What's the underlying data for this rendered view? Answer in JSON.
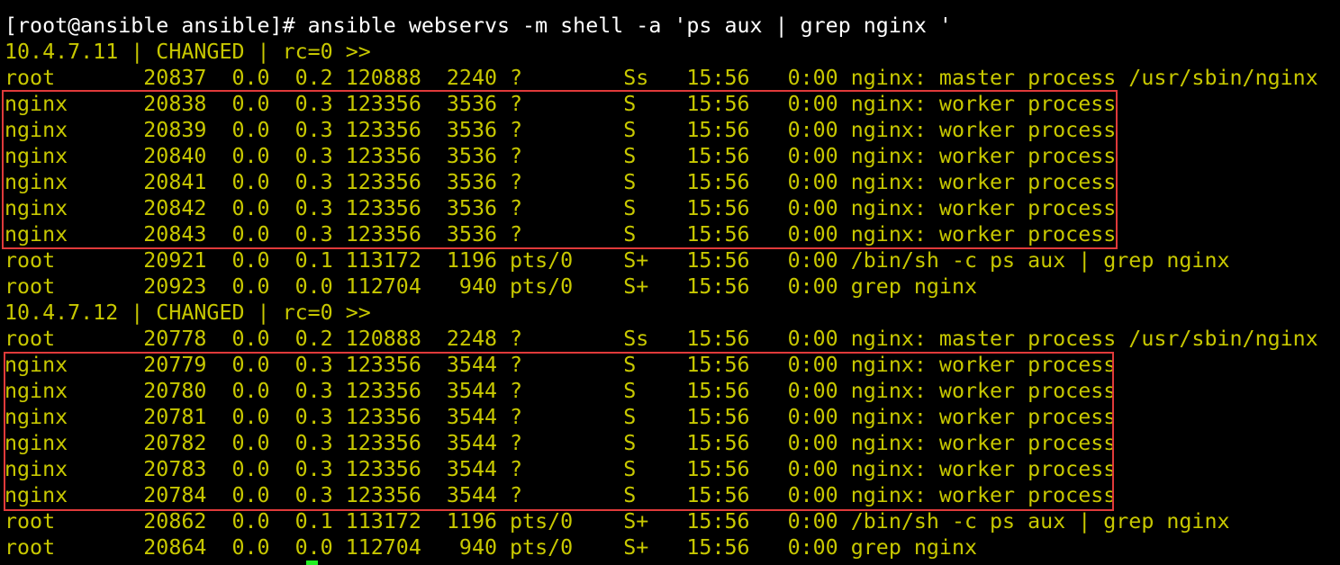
{
  "terminal": {
    "command": "[root@ansible ansible]# ansible webservs -m shell -a 'ps aux | grep nginx '",
    "hosts": [
      {
        "header": "10.4.7.11 | CHANGED | rc=0 >>",
        "master": "root       20837  0.0  0.2 120888  2240 ?        Ss   15:56   0:00 nginx: master process /usr/sbin/nginx",
        "workers": [
          "nginx      20838  0.0  0.3 123356  3536 ?        S    15:56   0:00 nginx: worker process",
          "nginx      20839  0.0  0.3 123356  3536 ?        S    15:56   0:00 nginx: worker process",
          "nginx      20840  0.0  0.3 123356  3536 ?        S    15:56   0:00 nginx: worker process",
          "nginx      20841  0.0  0.3 123356  3536 ?        S    15:56   0:00 nginx: worker process",
          "nginx      20842  0.0  0.3 123356  3536 ?        S    15:56   0:00 nginx: worker process",
          "nginx      20843  0.0  0.3 123356  3536 ?        S    15:56   0:00 nginx: worker process"
        ],
        "tail": [
          "root       20921  0.0  0.1 113172  1196 pts/0    S+   15:56   0:00 /bin/sh -c ps aux | grep nginx",
          "root       20923  0.0  0.0 112704   940 pts/0    S+   15:56   0:00 grep nginx"
        ]
      },
      {
        "header": "10.4.7.12 | CHANGED | rc=0 >>",
        "master": "root       20778  0.0  0.2 120888  2248 ?        Ss   15:56   0:00 nginx: master process /usr/sbin/nginx",
        "workers": [
          "nginx      20779  0.0  0.3 123356  3544 ?        S    15:56   0:00 nginx: worker process",
          "nginx      20780  0.0  0.3 123356  3544 ?        S    15:56   0:00 nginx: worker process",
          "nginx      20781  0.0  0.3 123356  3544 ?        S    15:56   0:00 nginx: worker process",
          "nginx      20782  0.0  0.3 123356  3544 ?        S    15:56   0:00 nginx: worker process",
          "nginx      20783  0.0  0.3 123356  3544 ?        S    15:56   0:00 nginx: worker process",
          "nginx      20784  0.0  0.3 123356  3544 ?        S    15:56   0:00 nginx: worker process"
        ],
        "tail": [
          "root       20862  0.0  0.1 113172  1196 pts/0    S+   15:56   0:00 /bin/sh -c ps aux | grep nginx",
          "root       20864  0.0  0.0 112704   940 pts/0    S+   15:56   0:00 grep nginx"
        ]
      }
    ],
    "colors": {
      "background": "#000000",
      "command_text": "#ffffff",
      "output_text": "#c8c800",
      "highlight_border": "#e03a3a",
      "cursor": "#22ee22"
    }
  }
}
